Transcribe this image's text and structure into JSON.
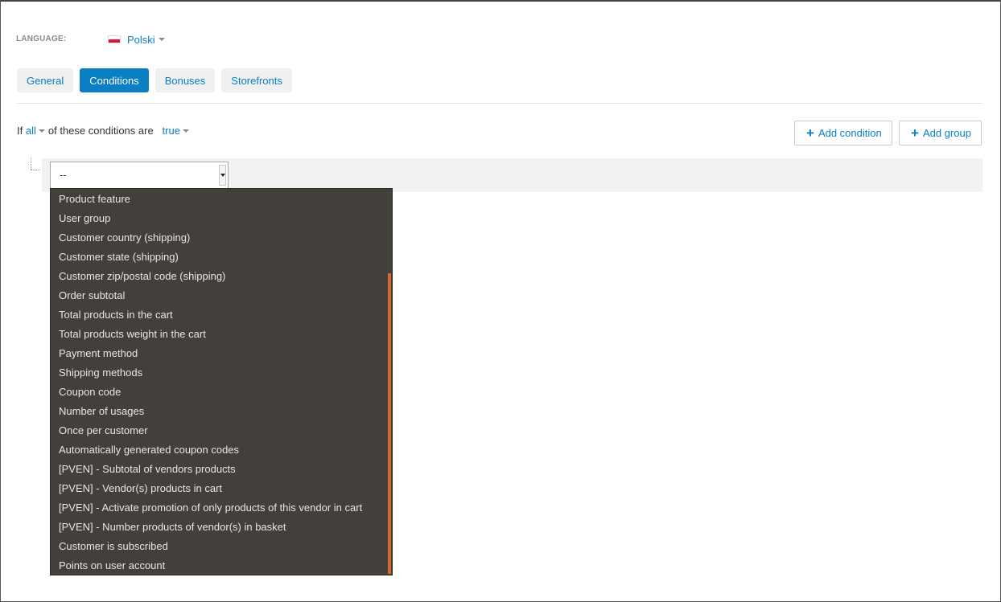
{
  "language": {
    "label": "LANGUAGE:",
    "value": "Polski"
  },
  "tabs": [
    {
      "label": "General",
      "active": false
    },
    {
      "label": "Conditions",
      "active": true
    },
    {
      "label": "Bonuses",
      "active": false
    },
    {
      "label": "Storefronts",
      "active": false
    }
  ],
  "condition": {
    "prefix": "If",
    "match": "all",
    "middle": "of these conditions are",
    "value": "true"
  },
  "buttons": {
    "add_condition": "Add condition",
    "add_group": "Add group"
  },
  "select": {
    "value": "--",
    "options": [
      "Product feature",
      "User group",
      "Customer country (shipping)",
      "Customer state (shipping)",
      "Customer zip/postal code (shipping)",
      "Order subtotal",
      "Total products in the cart",
      "Total products weight in the cart",
      "Payment method",
      "Shipping methods",
      "Coupon code",
      "Number of usages",
      "Once per customer",
      "Automatically generated coupon codes",
      "[PVEN] - Subtotal of vendors products",
      "[PVEN] - Vendor(s) products in cart",
      "[PVEN] - Activate promotion of only products of this vendor in cart",
      "[PVEN] - Number products of vendor(s) in basket",
      "Customer is subscribed",
      "Points on user account"
    ]
  },
  "colors": {
    "accent": "#0b7fc4",
    "dropdown_bg": "#43403c",
    "scrollbar": "#d2692f"
  },
  "icons": {
    "flag": "poland-flag-icon",
    "plus": "plus-icon",
    "caret": "caret-down-icon"
  }
}
